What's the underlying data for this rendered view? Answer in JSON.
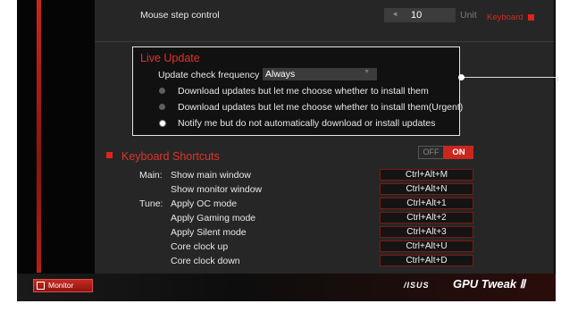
{
  "mouse_step": {
    "label": "Mouse step control",
    "value": "10",
    "unit": "Unit",
    "arrow_glyph": "◄"
  },
  "keyboard_link": {
    "label": "Keyboard"
  },
  "live_update": {
    "title": "Live Update",
    "frequency_label": "Update check frequency",
    "frequency_value": "Always",
    "frequency_chevron": "▼",
    "options": [
      {
        "label": "Download updates but let me choose whether to install them",
        "selected": false
      },
      {
        "label": "Download updates but let me choose whether to install them(Urgent)",
        "selected": false
      },
      {
        "label": "Notify me but do not automatically download or install updates",
        "selected": true
      }
    ]
  },
  "keyboard_shortcuts": {
    "title": "Keyboard Shortcuts",
    "toggle": {
      "off_label": "OFF",
      "on_label": "ON",
      "state": "ON"
    },
    "groups": {
      "main": "Main:",
      "tune": "Tune:"
    },
    "rows": [
      {
        "group": "Main:",
        "action": "Show main window",
        "keys": "Ctrl+Alt+M"
      },
      {
        "group": "",
        "action": "Show monitor window",
        "keys": "Ctrl+Alt+N"
      },
      {
        "group": "Tune:",
        "action": "Apply OC mode",
        "keys": "Ctrl+Alt+1"
      },
      {
        "group": "",
        "action": "Apply Gaming mode",
        "keys": "Ctrl+Alt+2"
      },
      {
        "group": "",
        "action": "Apply Silent mode",
        "keys": "Ctrl+Alt+3"
      },
      {
        "group": "",
        "action": "Core clock up",
        "keys": "Ctrl+Alt+U"
      },
      {
        "group": "",
        "action": "Core clock down",
        "keys": "Ctrl+Alt+D"
      }
    ]
  },
  "footer": {
    "monitor_button": "Monitor",
    "brand_asus": "/ISUS",
    "brand_product": "GPU Tweak Ⅱ"
  },
  "colors": {
    "accent_red": "#e0231b",
    "panel_bg": "#262626"
  }
}
